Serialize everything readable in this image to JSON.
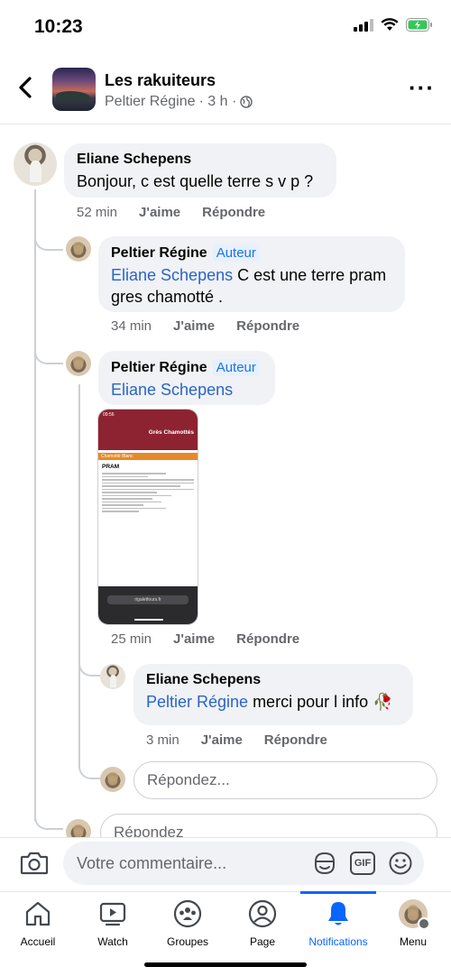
{
  "status": {
    "time": "10:23"
  },
  "header": {
    "group_name": "Les rakuiteurs",
    "poster": "Peltier Régine",
    "age": "· 3 h ·"
  },
  "comments": [
    {
      "author": "Eliane Schepens",
      "text": "Bonjour,  c est quelle terre s v p ?",
      "time": "52 min",
      "like": "J'aime",
      "reply": "Répondre"
    },
    {
      "author": "Peltier Régine",
      "badge": "Auteur",
      "mention": "Eliane Schepens",
      "text": " C est une terre pram gres chamotté .",
      "time": "34 min",
      "like": "J'aime",
      "reply": "Répondre"
    },
    {
      "author": "Peltier Régine",
      "badge": "Auteur",
      "mention": "Eliane Schepens",
      "text": "",
      "time": "25 min",
      "like": "J'aime",
      "reply": "Répondre"
    },
    {
      "author": "Eliane Schepens",
      "mention": "Peltier Régine",
      "text": " merci pour l info ",
      "emoji": "🥀",
      "time": "3 min",
      "like": "J'aime",
      "reply": "Répondre"
    }
  ],
  "attachment": {
    "status_time": "09:56",
    "header_title": "Grès Chamottés",
    "band_label": "Chamotté Blanc",
    "product": "PRAM",
    "url": "rigaletfours.fr"
  },
  "reply_placeholder": "Répondez...",
  "reply_placeholder_outer": "Répondez",
  "composer": {
    "placeholder": "Votre commentaire...",
    "gif_label": "GIF"
  },
  "tabs": [
    {
      "label": "Accueil",
      "icon": "home-icon"
    },
    {
      "label": "Watch",
      "icon": "watch-icon"
    },
    {
      "label": "Groupes",
      "icon": "groups-icon"
    },
    {
      "label": "Page",
      "icon": "page-icon"
    },
    {
      "label": "Notifications",
      "icon": "bell-icon",
      "active": true
    },
    {
      "label": "Menu",
      "icon": "menu-avatar"
    }
  ],
  "colors": {
    "accent": "#0866ff",
    "mention": "#2c64c6",
    "bubble": "#f0f2f5"
  }
}
